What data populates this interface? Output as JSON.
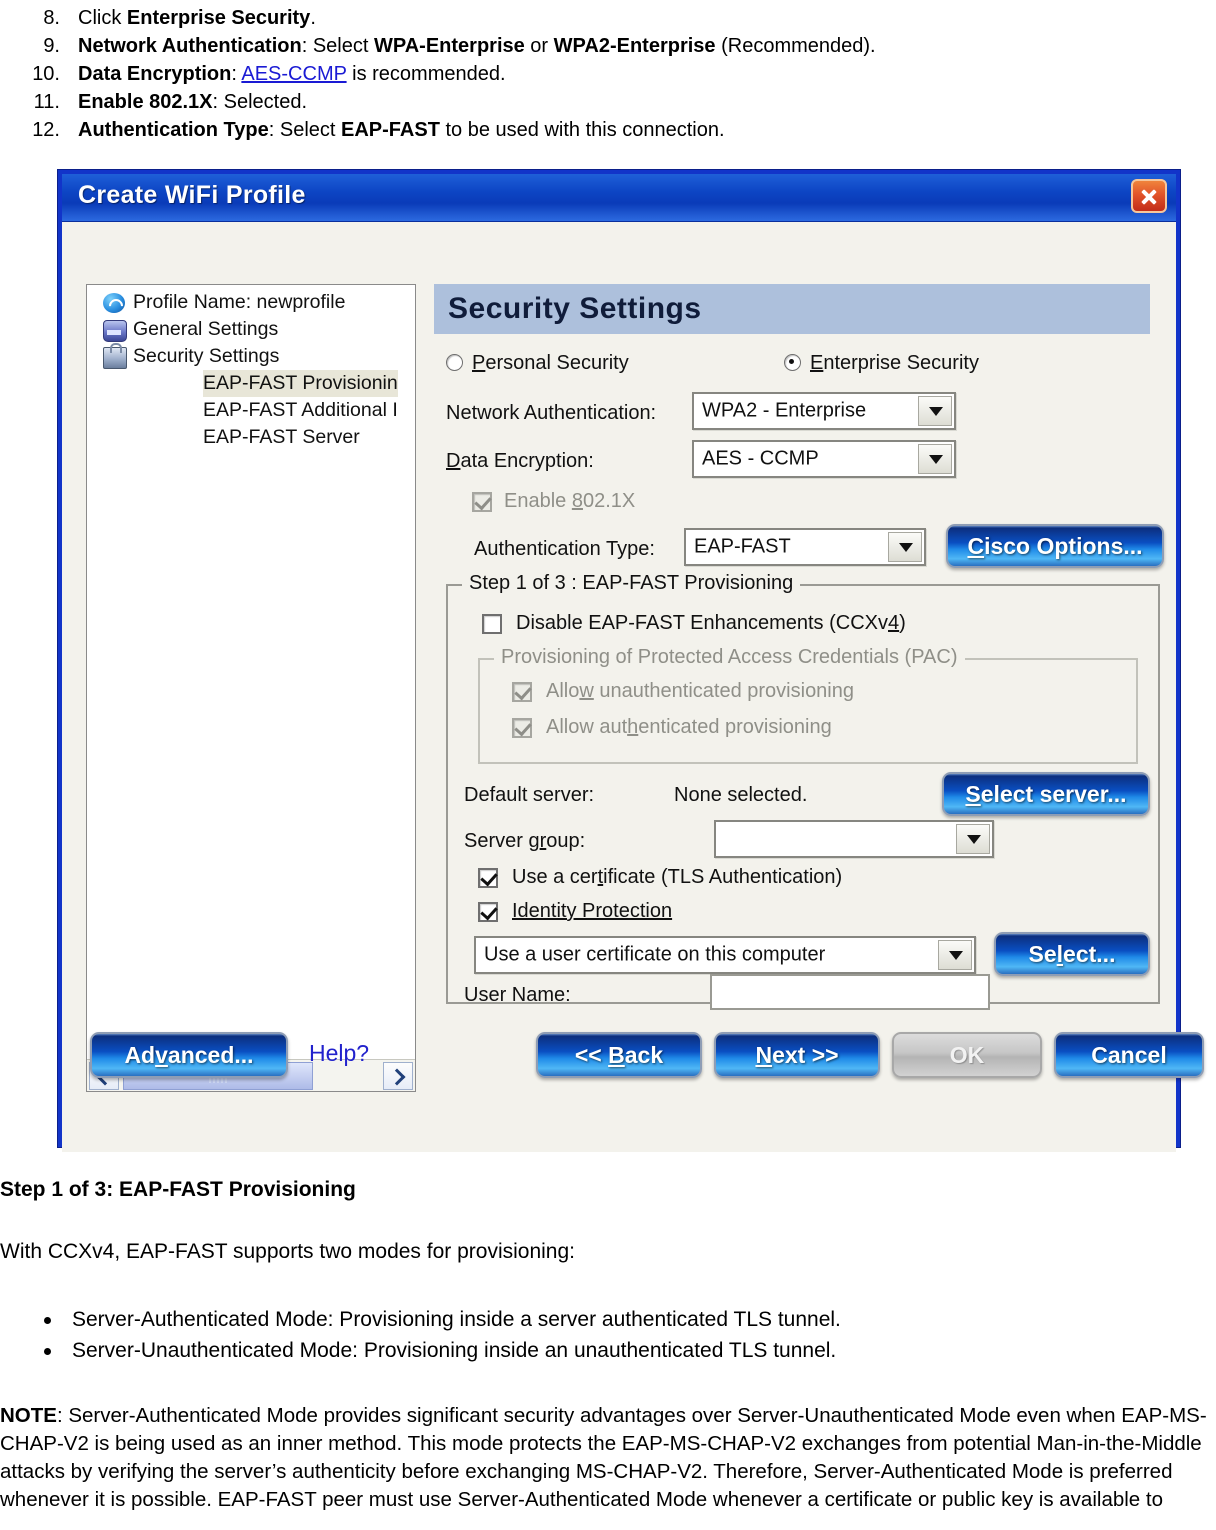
{
  "instructions": [
    {
      "num": "8.",
      "parts": [
        {
          "t": "Click ",
          "s": "n"
        },
        {
          "t": "Enterprise Security",
          "s": "b"
        },
        {
          "t": ".",
          "s": "n"
        }
      ]
    },
    {
      "num": "9.",
      "parts": [
        {
          "t": "Network Authentication",
          "s": "b"
        },
        {
          "t": ": Select ",
          "s": "n"
        },
        {
          "t": "WPA-Enterprise",
          "s": "b"
        },
        {
          "t": " or ",
          "s": "n"
        },
        {
          "t": "WPA2-Enterprise",
          "s": "b"
        },
        {
          "t": " (Recommended).",
          "s": "n"
        }
      ]
    },
    {
      "num": "10.",
      "parts": [
        {
          "t": "Data Encryption",
          "s": "b"
        },
        {
          "t": ": ",
          "s": "n"
        },
        {
          "t": "AES-CCMP",
          "s": "l"
        },
        {
          "t": " is recommended.",
          "s": "n"
        }
      ]
    },
    {
      "num": "11.",
      "parts": [
        {
          "t": "Enable 802.1X",
          "s": "b"
        },
        {
          "t": ": Selected.",
          "s": "n"
        }
      ]
    },
    {
      "num": "12.",
      "parts": [
        {
          "t": "Authentication Type",
          "s": "b"
        },
        {
          "t": ": Select ",
          "s": "n"
        },
        {
          "t": "EAP-FAST",
          "s": "b"
        },
        {
          "t": " to be used with this connection.",
          "s": "n"
        }
      ]
    }
  ],
  "dialog": {
    "title": "Create WiFi Profile",
    "close_icon": "close-icon",
    "tree": {
      "items": [
        {
          "label": "Profile Name: newprofile",
          "icon": "wifi-icon",
          "level": 0,
          "selected": false
        },
        {
          "label": "General Settings",
          "icon": "gear-icon",
          "level": 0,
          "selected": false
        },
        {
          "label": "Security Settings",
          "icon": "lock-icon",
          "level": 0,
          "selected": false
        },
        {
          "label": "EAP-FAST Provisionin",
          "icon": "",
          "level": 1,
          "selected": true
        },
        {
          "label": "EAP-FAST Additional I",
          "icon": "",
          "level": 1,
          "selected": false
        },
        {
          "label": "EAP-FAST Server",
          "icon": "",
          "level": 1,
          "selected": false
        }
      ]
    },
    "pane": {
      "heading": "Security Settings",
      "security_mode": {
        "personal_label": "Personal Security",
        "enterprise_label": "Enterprise Security",
        "selected": "Enterprise Security"
      },
      "network_authentication": {
        "label": "Network Authentication:",
        "value": "WPA2 - Enterprise"
      },
      "data_encryption": {
        "label": "Data Encryption:",
        "value": "AES - CCMP"
      },
      "enable_8021x": {
        "label": "Enable 802.1X",
        "checked": true,
        "disabled": true
      },
      "authentication_type": {
        "label": "Authentication Type:",
        "value": "EAP-FAST"
      },
      "cisco_options_button": "Cisco Options...",
      "step_group": {
        "title": "Step 1 of 3 : EAP-FAST Provisioning",
        "disable_enhancements": {
          "label": "Disable EAP-FAST Enhancements (CCXv4)",
          "checked": false
        },
        "pac_group": {
          "title": "Provisioning of Protected Access Credentials (PAC)",
          "items": [
            {
              "label": "Allow unauthenticated provisioning",
              "checked": true,
              "disabled": true
            },
            {
              "label": "Allow authenticated provisioning",
              "checked": true,
              "disabled": true
            }
          ]
        },
        "default_server": {
          "label": "Default server:",
          "value": "None selected.",
          "button": "Select server..."
        },
        "server_group": {
          "label": "Server group:",
          "value": ""
        },
        "use_certificate": {
          "label": "Use a certificate (TLS Authentication)",
          "checked": true
        },
        "identity_protection": {
          "label": "Identity Protection",
          "checked": true
        },
        "certificate_source": {
          "value": "Use a user certificate on this computer",
          "button": "Select..."
        },
        "user_name": {
          "label": "User Name:",
          "value": ""
        }
      }
    },
    "footer": {
      "advanced": "Advanced...",
      "help": "Help?",
      "back": "<< Back",
      "next": "Next >>",
      "ok": "OK",
      "cancel": "Cancel",
      "ok_disabled": true
    },
    "colors": {
      "titlebar_blue": "#0d45c4",
      "frame_blue": "#1234c9",
      "heading_band": "#adc0dc",
      "button_blue": "#1f8ae8",
      "close_red": "#e2542a",
      "link_blue": "#2222cc"
    }
  },
  "post": {
    "heading": "Step 1 of 3: EAP-FAST Provisioning",
    "intro": "With CCXv4, EAP-FAST supports two modes for provisioning:",
    "bullets": [
      "Server-Authenticated Mode: Provisioning inside a server authenticated TLS tunnel.",
      "Server-Unauthenticated Mode: Provisioning inside an unauthenticated TLS tunnel."
    ],
    "note_label": "NOTE",
    "note_body": ": Server-Authenticated Mode provides significant security advantages over Server-Unauthenticated Mode even when EAP-MS-CHAP-V2 is being used as an inner method. This mode protects the EAP-MS-CHAP-V2 exchanges from potential Man-in-the-Middle attacks by verifying the server’s authenticity before exchanging MS-CHAP-V2. Therefore, Server-Authenticated Mode is preferred whenever it is possible. EAP-FAST peer must use Server-Authenticated Mode whenever a certificate or public key is available to"
  }
}
